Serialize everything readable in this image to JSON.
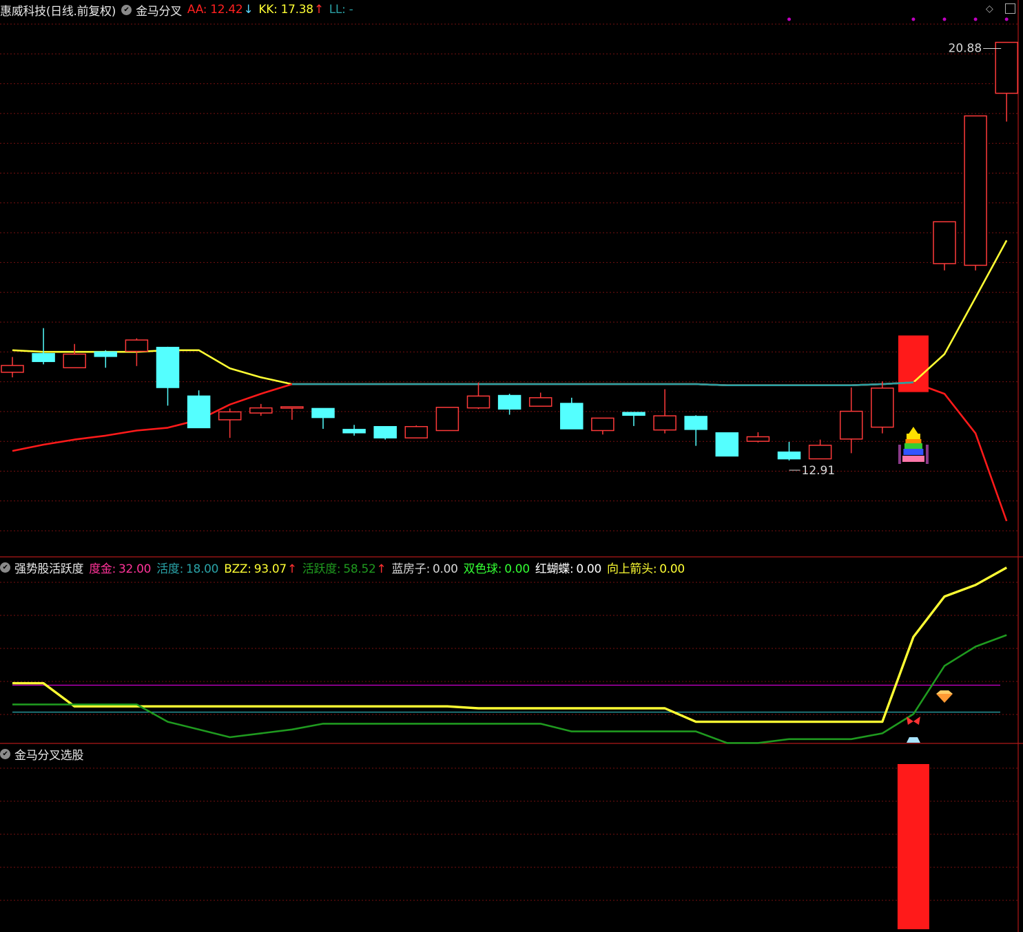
{
  "colors": {
    "background": "#000000",
    "grid": "#7a1010",
    "pane_border": "#b01818",
    "up_candle": "#ff3a3a",
    "down_candle": "#54ffff",
    "yellow": "#ffff33",
    "red": "#ff1a1a",
    "teal": "#2a9fa3",
    "magenta": "#c000c0",
    "green": "#1f8a1f"
  },
  "main_panel": {
    "stock_name": "惠威科技",
    "period": "(日线.前复权)",
    "indicator_name": "金马分叉",
    "aa_label": "AA:",
    "aa_value": "12.42",
    "aa_arrow": "↓",
    "kk_label": "KK:",
    "kk_value": "17.38",
    "kk_arrow": "↑",
    "ll_label": "LL:",
    "ll_value": "-",
    "high_label": "20.88",
    "low_label": "12.91"
  },
  "activity_panel": {
    "title": "强势股活跃度",
    "items": [
      {
        "label": "度金:",
        "value": "32.00",
        "color": "#ff3399",
        "arrow": ""
      },
      {
        "label": "活度:",
        "value": "18.00",
        "color": "#2aa3a8",
        "arrow": ""
      },
      {
        "label": "BZZ:",
        "value": "93.07",
        "color": "#ffff33",
        "arrow": "↑"
      },
      {
        "label": "活跃度:",
        "value": "58.52",
        "color": "#1f9a1f",
        "arrow": "↑"
      },
      {
        "label": "蓝房子:",
        "value": "0.00",
        "color": "#d8d8d8",
        "arrow": ""
      },
      {
        "label": "双色球:",
        "value": "0.00",
        "color": "#33ff33",
        "arrow": ""
      },
      {
        "label": "红蝴蝶:",
        "value": "0.00",
        "color": "#ffffff",
        "arrow": ""
      },
      {
        "label": "向上箭头:",
        "value": "0.00",
        "color": "#ffff33",
        "arrow": ""
      }
    ]
  },
  "select_panel": {
    "title": "金马分叉选股"
  },
  "chart_data": [
    {
      "type": "candlestick",
      "title": "惠威科技 (日线.前复权) 金马分叉",
      "ylim": [
        11.8,
        21.3
      ],
      "grid": true,
      "candles": [
        {
          "o": 15.05,
          "c": 15.17,
          "h": 15.32,
          "l": 14.96
        },
        {
          "o": 15.38,
          "c": 15.24,
          "h": 15.83,
          "l": 15.19
        },
        {
          "o": 15.13,
          "c": 15.37,
          "h": 15.55,
          "l": 15.13
        },
        {
          "o": 15.41,
          "c": 15.33,
          "h": 15.44,
          "l": 15.13
        },
        {
          "o": 15.42,
          "c": 15.62,
          "h": 15.65,
          "l": 15.16
        },
        {
          "o": 15.49,
          "c": 14.78,
          "h": 15.5,
          "l": 14.46
        },
        {
          "o": 14.63,
          "c": 14.07,
          "h": 14.73,
          "l": 14.07
        },
        {
          "o": 14.21,
          "c": 14.35,
          "h": 14.41,
          "l": 13.89
        },
        {
          "o": 14.33,
          "c": 14.42,
          "h": 14.49,
          "l": 14.28
        },
        {
          "o": 14.44,
          "c": 14.44,
          "h": 14.44,
          "l": 14.21
        },
        {
          "o": 14.41,
          "c": 14.25,
          "h": 14.41,
          "l": 14.05
        },
        {
          "o": 14.04,
          "c": 13.98,
          "h": 14.12,
          "l": 13.93
        },
        {
          "o": 14.09,
          "c": 13.89,
          "h": 14.09,
          "l": 13.86
        },
        {
          "o": 13.89,
          "c": 14.09,
          "h": 14.11,
          "l": 13.89
        },
        {
          "o": 14.02,
          "c": 14.43,
          "h": 14.43,
          "l": 14.02
        },
        {
          "o": 14.42,
          "c": 14.63,
          "h": 14.87,
          "l": 14.4
        },
        {
          "o": 14.64,
          "c": 14.4,
          "h": 14.67,
          "l": 14.3
        },
        {
          "o": 14.45,
          "c": 14.6,
          "h": 14.69,
          "l": 14.45
        },
        {
          "o": 14.5,
          "c": 14.05,
          "h": 14.6,
          "l": 14.05
        },
        {
          "o": 14.02,
          "c": 14.24,
          "h": 14.24,
          "l": 13.95
        },
        {
          "o": 14.34,
          "c": 14.29,
          "h": 14.34,
          "l": 14.1
        },
        {
          "o": 14.03,
          "c": 14.28,
          "h": 14.75,
          "l": 13.97
        },
        {
          "o": 14.27,
          "c": 14.04,
          "h": 14.29,
          "l": 13.75
        },
        {
          "o": 13.98,
          "c": 13.57,
          "h": 13.98,
          "l": 13.57
        },
        {
          "o": 13.83,
          "c": 13.91,
          "h": 13.99,
          "l": 13.81
        },
        {
          "o": 13.64,
          "c": 13.52,
          "h": 13.82,
          "l": 13.49
        },
        {
          "o": 13.52,
          "c": 13.76,
          "h": 13.86,
          "l": 13.52
        },
        {
          "o": 13.87,
          "c": 14.36,
          "h": 14.78,
          "l": 13.62
        },
        {
          "o": 14.08,
          "c": 14.77,
          "h": 14.89,
          "l": 13.97
        },
        {
          "o": 15.7,
          "c": 14.7,
          "h": 14.7,
          "l": 14.7,
          "signal": true
        },
        {
          "o": 16.97,
          "c": 17.71,
          "h": 17.71,
          "l": 16.85
        },
        {
          "o": 16.94,
          "c": 19.58,
          "h": 19.58,
          "l": 16.85
        },
        {
          "o": 19.98,
          "c": 20.88,
          "h": 20.88,
          "l": 19.48
        }
      ],
      "series": [
        {
          "name": "KK",
          "color": "#ffff33",
          "values": [
            15.44,
            15.41,
            15.41,
            15.41,
            15.41,
            15.44,
            15.44,
            15.12,
            14.96,
            14.84,
            14.84,
            14.84,
            14.84,
            14.84,
            14.84,
            14.84,
            14.84,
            14.84,
            14.84,
            14.84,
            14.84,
            14.84,
            14.84,
            14.82,
            14.82,
            14.82,
            14.82,
            14.82,
            14.84,
            14.87,
            15.37,
            16.37,
            17.38
          ]
        },
        {
          "name": "AA",
          "color": "#ff1a1a",
          "values": [
            13.66,
            13.77,
            13.86,
            13.93,
            14.02,
            14.07,
            14.21,
            14.48,
            14.67,
            14.84,
            14.84,
            14.84,
            14.84,
            14.84,
            14.84,
            14.84,
            14.84,
            14.84,
            14.84,
            14.84,
            14.84,
            14.84,
            14.84,
            14.82,
            14.82,
            14.82,
            14.82,
            14.82,
            14.84,
            14.87,
            14.67,
            13.97,
            12.42
          ]
        }
      ]
    },
    {
      "type": "line",
      "title": "强势股活跃度",
      "ylim": [
        0,
        100
      ],
      "series": [
        {
          "name": "BZZ",
          "color": "#ffff33",
          "values": [
            33,
            33,
            21,
            21,
            21,
            21,
            21,
            21,
            21,
            21,
            21,
            21,
            21,
            21,
            21,
            20,
            20,
            20,
            20,
            20,
            20,
            20,
            13,
            13,
            13,
            13,
            13,
            13,
            13,
            57,
            78,
            84,
            93
          ]
        },
        {
          "name": "活跃度",
          "color": "#1f9a1f",
          "values": [
            22,
            22,
            22,
            22,
            22,
            13,
            9,
            5,
            7,
            9,
            12,
            12,
            12,
            12,
            12,
            12,
            12,
            12,
            8,
            8,
            8,
            8,
            8,
            2,
            2,
            4,
            4,
            4,
            7,
            17,
            42,
            52,
            58
          ]
        }
      ],
      "levels": [
        {
          "name": "度金",
          "value": 32
        },
        {
          "name": "活度",
          "value": 18
        }
      ]
    },
    {
      "type": "bar",
      "title": "金马分叉选股",
      "ylim": [
        0,
        1
      ],
      "signals": [
        0,
        0,
        0,
        0,
        0,
        0,
        0,
        0,
        0,
        0,
        0,
        0,
        0,
        0,
        0,
        0,
        0,
        0,
        0,
        0,
        0,
        0,
        0,
        0,
        0,
        0,
        0,
        0,
        0,
        1,
        0,
        0,
        0
      ]
    }
  ]
}
